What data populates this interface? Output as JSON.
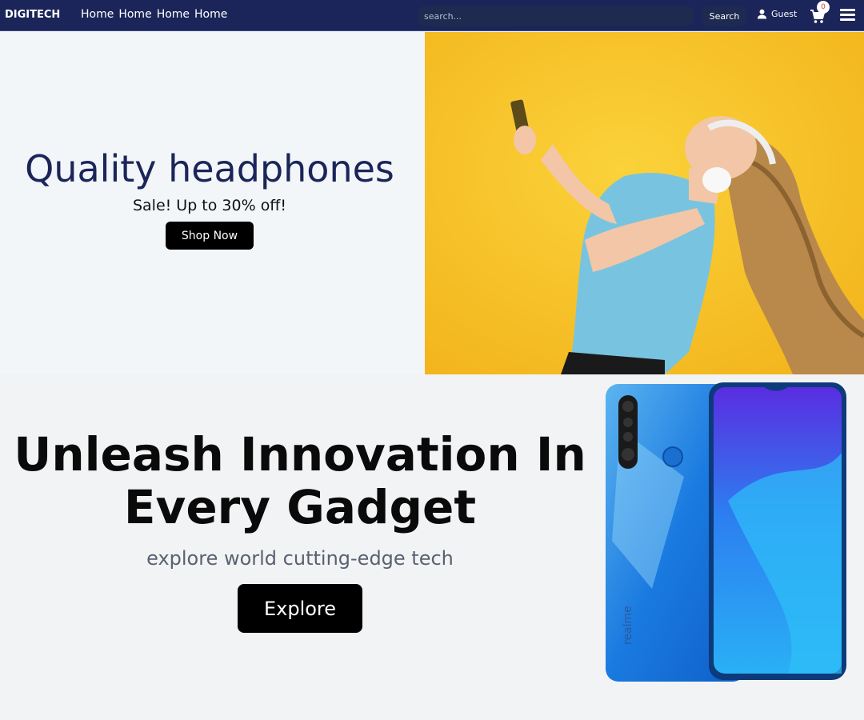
{
  "navbar": {
    "logo": "DIGITECH",
    "links": [
      "Home",
      "Home",
      "Home",
      "Home"
    ],
    "search_placeholder": "search...",
    "search_button": "Search",
    "user_label": "Guest",
    "cart_count": "0",
    "icons": {
      "user": "user-icon",
      "cart": "cart-icon",
      "menu": "hamburger-menu-icon"
    }
  },
  "hero1": {
    "title": "Quality headphones",
    "subtitle": "Sale! Up to 30% off!",
    "button": "Shop Now",
    "image": "woman-with-headphones-photo",
    "image_bg": "#f6bb22"
  },
  "hero2": {
    "title_line1": "Unleash Innovation In",
    "title_line2": "Every Gadget",
    "subtitle": "explore world cutting-edge tech",
    "button": "Explore",
    "image": "realme-smartphone-photo",
    "phone_brand": "realme"
  },
  "colors": {
    "nav_bg": "#1b2559",
    "accent_text": "#1b2559",
    "button_bg": "#000000"
  }
}
